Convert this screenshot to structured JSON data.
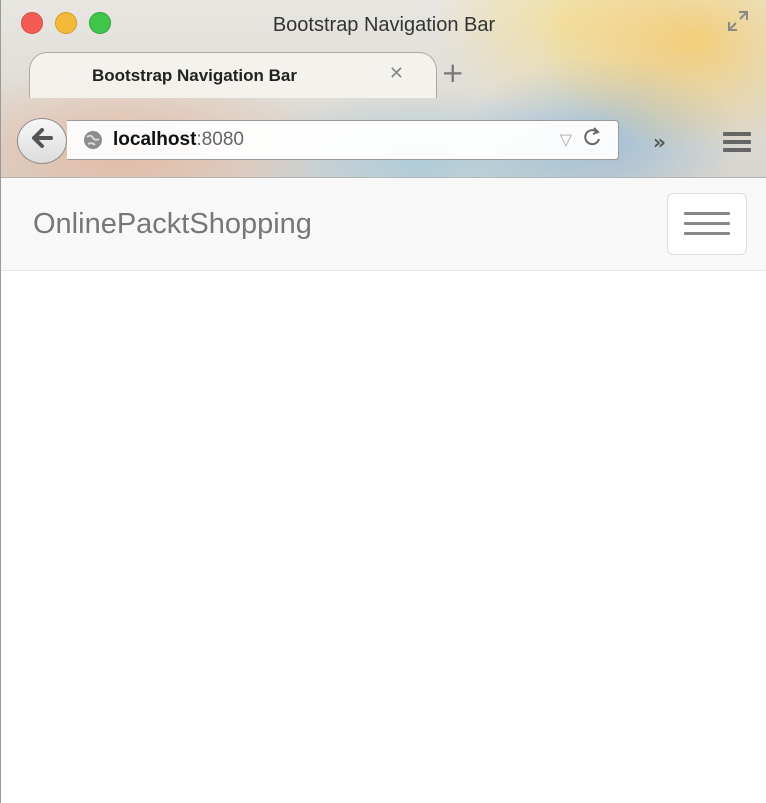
{
  "window": {
    "title": "Bootstrap Navigation Bar"
  },
  "tabs": [
    {
      "label": "Bootstrap Navigation Bar",
      "active": true
    }
  ],
  "toolbar": {
    "url_host": "localhost",
    "url_port": ":8080",
    "icons": [
      "back-arrow-icon",
      "globe-icon",
      "dropdown-triangle-icon",
      "reload-icon",
      "overflow-chevron-icon",
      "hamburger-menu-icon"
    ]
  },
  "page": {
    "navbar": {
      "brand": "OnlinePacktShopping",
      "toggle_icon": "hamburger-icon",
      "background": "#f8f8f8",
      "brand_color": "#777777"
    }
  }
}
